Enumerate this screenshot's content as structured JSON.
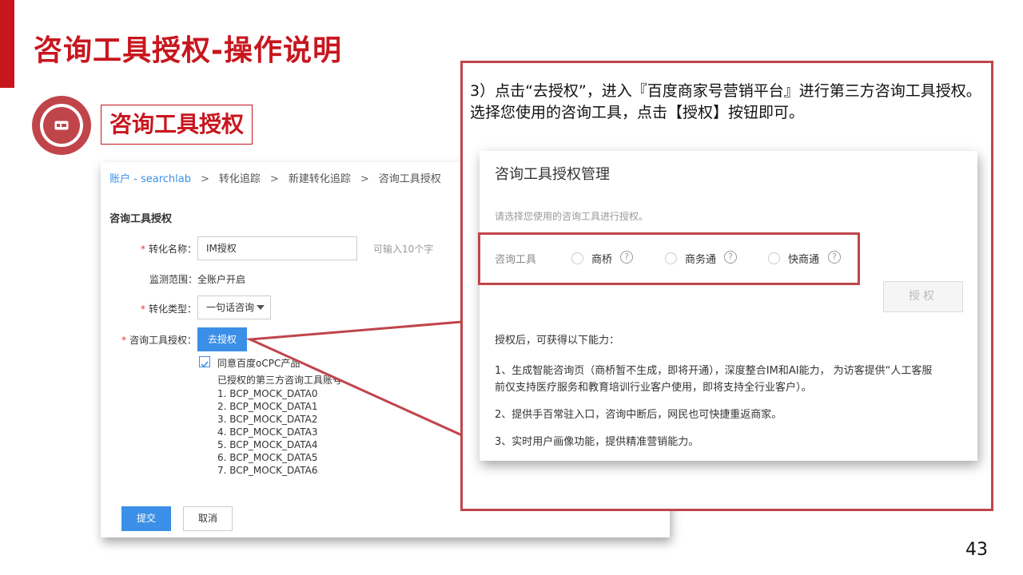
{
  "slide": {
    "title": "咨询工具授权-操作说明",
    "section_label": "咨询工具授权",
    "page_number": "43",
    "accent_color": "#c8161e"
  },
  "left_form": {
    "breadcrumb": [
      "账户 - searchlab",
      "转化追踪",
      "新建转化追踪",
      "咨询工具授权"
    ],
    "form_title": "咨询工具授权",
    "name_label": "转化名称：",
    "name_value": "IM授权",
    "name_hint": "可输入10个字",
    "scope_text": "监测范围：全账户开启",
    "type_label": "转化类型：",
    "type_value": "一句话咨询",
    "tool_label": "咨询工具授权：",
    "go_auth_button": "去授权",
    "agree_text": "同意百度oCPC产品",
    "accounts_title": "已授权的第三方咨询工具账号",
    "accounts": [
      "1. BCP_MOCK_DATA0",
      "2. BCP_MOCK_DATA1",
      "3. BCP_MOCK_DATA2",
      "4. BCP_MOCK_DATA3",
      "5. BCP_MOCK_DATA4",
      "6. BCP_MOCK_DATA5",
      "7. BCP_MOCK_DATA6"
    ],
    "submit_button": "提交",
    "cancel_button": "取消"
  },
  "callout": {
    "instruction": "3）点击“去授权”，进入『百度商家号营销平台』进行第三方咨询工具授权。选择您使用的咨询工具，点击【授权】按钮即可。",
    "dialog": {
      "title": "咨询工具授权管理",
      "hint": "请选择您使用的咨询工具进行授权。",
      "tool_label": "咨询工具",
      "options": [
        "商桥",
        "商务通",
        "快商通"
      ],
      "help_glyph": "?",
      "auth_button": "授权",
      "abilities_head": "授权后，可获得以下能力：",
      "ability_1a": "1、生成智能咨询页（商桥暂不生成，即将开通），深度整合IM和AI能力， 为访客提供“人工客服",
      "ability_1b": "前仅支持医疗服务和教育培训行业客户使用，即将支持全行业客户）。",
      "ability_2": "2、提供手百常驻入口，咨询中断后，网民也可快捷重返商家。",
      "ability_3": "3、实时用户画像功能，提供精准营销能力。"
    }
  }
}
